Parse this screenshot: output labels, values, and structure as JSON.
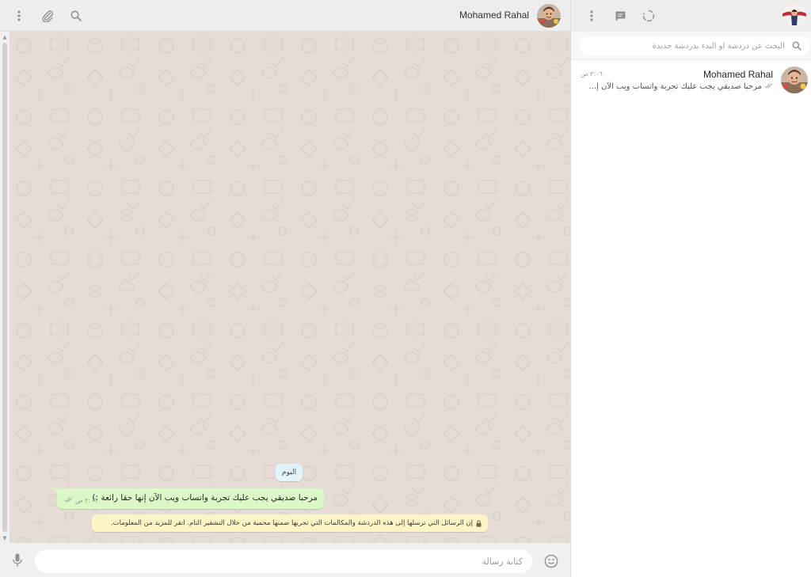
{
  "chat_header": {
    "contact_name": "Mohamed Rahal",
    "icons": [
      "menu-dots-icon",
      "attach-icon",
      "search-icon"
    ]
  },
  "messages": {
    "date_chip": "اليوم",
    "outgoing": [
      {
        "text": "مرحبا صديقي يجب عليك تجربة واتساب ويب الآن إنها حقا رائعة :)",
        "time": "٢:٠٦ ص",
        "status": "double-check-icon"
      }
    ],
    "encryption_notice": "إن الرسائل التي ترسلها إلى هذه الدردشة والمكالمات التي تجريها ضمنها محمية من خلال التشفير التام. انقر للمزيد من المعلومات."
  },
  "composer": {
    "placeholder": "كتابة رسالة",
    "icons": [
      "mic-icon",
      "emoji-icon"
    ]
  },
  "sidebar": {
    "header_icons": [
      "menu-dots-icon",
      "new-chat-icon",
      "status-icon"
    ],
    "search_placeholder": "البحث عن دردشة أو البدء بدردشة جديدة",
    "chats": [
      {
        "name": "Mohamed Rahal",
        "time": "٢:٠٦ ص",
        "preview": "مرحبا صديقي يجب عليك تجربة واتساب ويب الآن إ..."
      }
    ]
  },
  "colors": {
    "chat_background": "#e5ddd5",
    "outgoing_bubble": "#dcf8c6",
    "date_chip": "#e1f3fb",
    "encryption_notice": "#fdf4c5",
    "header": "#ededed",
    "icon_gray": "#919191"
  }
}
